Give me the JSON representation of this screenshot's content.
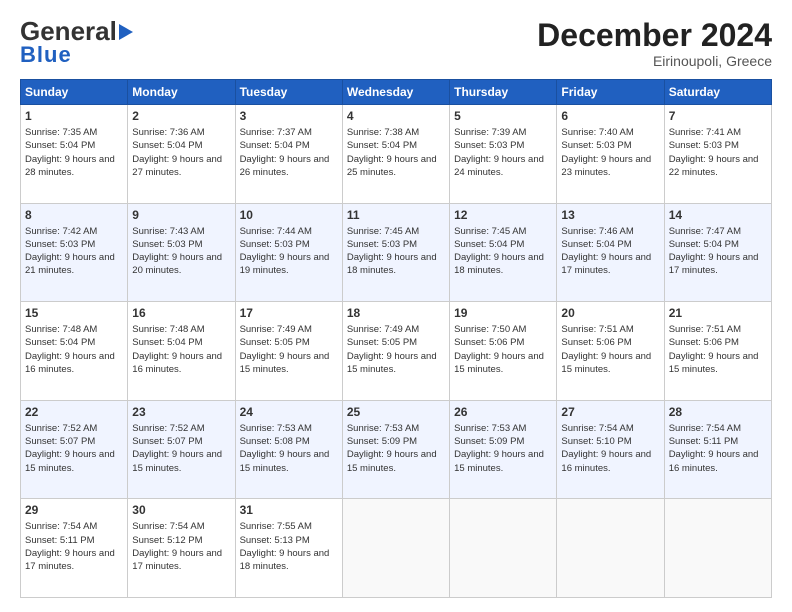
{
  "header": {
    "logo_general": "General",
    "logo_blue": "Blue",
    "month_title": "December 2024",
    "location": "Eirinoupoli, Greece"
  },
  "weekdays": [
    "Sunday",
    "Monday",
    "Tuesday",
    "Wednesday",
    "Thursday",
    "Friday",
    "Saturday"
  ],
  "weeks": [
    [
      {
        "day": "1",
        "sunrise": "Sunrise: 7:35 AM",
        "sunset": "Sunset: 5:04 PM",
        "daylight": "Daylight: 9 hours and 28 minutes."
      },
      {
        "day": "2",
        "sunrise": "Sunrise: 7:36 AM",
        "sunset": "Sunset: 5:04 PM",
        "daylight": "Daylight: 9 hours and 27 minutes."
      },
      {
        "day": "3",
        "sunrise": "Sunrise: 7:37 AM",
        "sunset": "Sunset: 5:04 PM",
        "daylight": "Daylight: 9 hours and 26 minutes."
      },
      {
        "day": "4",
        "sunrise": "Sunrise: 7:38 AM",
        "sunset": "Sunset: 5:04 PM",
        "daylight": "Daylight: 9 hours and 25 minutes."
      },
      {
        "day": "5",
        "sunrise": "Sunrise: 7:39 AM",
        "sunset": "Sunset: 5:03 PM",
        "daylight": "Daylight: 9 hours and 24 minutes."
      },
      {
        "day": "6",
        "sunrise": "Sunrise: 7:40 AM",
        "sunset": "Sunset: 5:03 PM",
        "daylight": "Daylight: 9 hours and 23 minutes."
      },
      {
        "day": "7",
        "sunrise": "Sunrise: 7:41 AM",
        "sunset": "Sunset: 5:03 PM",
        "daylight": "Daylight: 9 hours and 22 minutes."
      }
    ],
    [
      {
        "day": "8",
        "sunrise": "Sunrise: 7:42 AM",
        "sunset": "Sunset: 5:03 PM",
        "daylight": "Daylight: 9 hours and 21 minutes."
      },
      {
        "day": "9",
        "sunrise": "Sunrise: 7:43 AM",
        "sunset": "Sunset: 5:03 PM",
        "daylight": "Daylight: 9 hours and 20 minutes."
      },
      {
        "day": "10",
        "sunrise": "Sunrise: 7:44 AM",
        "sunset": "Sunset: 5:03 PM",
        "daylight": "Daylight: 9 hours and 19 minutes."
      },
      {
        "day": "11",
        "sunrise": "Sunrise: 7:45 AM",
        "sunset": "Sunset: 5:03 PM",
        "daylight": "Daylight: 9 hours and 18 minutes."
      },
      {
        "day": "12",
        "sunrise": "Sunrise: 7:45 AM",
        "sunset": "Sunset: 5:04 PM",
        "daylight": "Daylight: 9 hours and 18 minutes."
      },
      {
        "day": "13",
        "sunrise": "Sunrise: 7:46 AM",
        "sunset": "Sunset: 5:04 PM",
        "daylight": "Daylight: 9 hours and 17 minutes."
      },
      {
        "day": "14",
        "sunrise": "Sunrise: 7:47 AM",
        "sunset": "Sunset: 5:04 PM",
        "daylight": "Daylight: 9 hours and 17 minutes."
      }
    ],
    [
      {
        "day": "15",
        "sunrise": "Sunrise: 7:48 AM",
        "sunset": "Sunset: 5:04 PM",
        "daylight": "Daylight: 9 hours and 16 minutes."
      },
      {
        "day": "16",
        "sunrise": "Sunrise: 7:48 AM",
        "sunset": "Sunset: 5:04 PM",
        "daylight": "Daylight: 9 hours and 16 minutes."
      },
      {
        "day": "17",
        "sunrise": "Sunrise: 7:49 AM",
        "sunset": "Sunset: 5:05 PM",
        "daylight": "Daylight: 9 hours and 15 minutes."
      },
      {
        "day": "18",
        "sunrise": "Sunrise: 7:49 AM",
        "sunset": "Sunset: 5:05 PM",
        "daylight": "Daylight: 9 hours and 15 minutes."
      },
      {
        "day": "19",
        "sunrise": "Sunrise: 7:50 AM",
        "sunset": "Sunset: 5:06 PM",
        "daylight": "Daylight: 9 hours and 15 minutes."
      },
      {
        "day": "20",
        "sunrise": "Sunrise: 7:51 AM",
        "sunset": "Sunset: 5:06 PM",
        "daylight": "Daylight: 9 hours and 15 minutes."
      },
      {
        "day": "21",
        "sunrise": "Sunrise: 7:51 AM",
        "sunset": "Sunset: 5:06 PM",
        "daylight": "Daylight: 9 hours and 15 minutes."
      }
    ],
    [
      {
        "day": "22",
        "sunrise": "Sunrise: 7:52 AM",
        "sunset": "Sunset: 5:07 PM",
        "daylight": "Daylight: 9 hours and 15 minutes."
      },
      {
        "day": "23",
        "sunrise": "Sunrise: 7:52 AM",
        "sunset": "Sunset: 5:07 PM",
        "daylight": "Daylight: 9 hours and 15 minutes."
      },
      {
        "day": "24",
        "sunrise": "Sunrise: 7:53 AM",
        "sunset": "Sunset: 5:08 PM",
        "daylight": "Daylight: 9 hours and 15 minutes."
      },
      {
        "day": "25",
        "sunrise": "Sunrise: 7:53 AM",
        "sunset": "Sunset: 5:09 PM",
        "daylight": "Daylight: 9 hours and 15 minutes."
      },
      {
        "day": "26",
        "sunrise": "Sunrise: 7:53 AM",
        "sunset": "Sunset: 5:09 PM",
        "daylight": "Daylight: 9 hours and 15 minutes."
      },
      {
        "day": "27",
        "sunrise": "Sunrise: 7:54 AM",
        "sunset": "Sunset: 5:10 PM",
        "daylight": "Daylight: 9 hours and 16 minutes."
      },
      {
        "day": "28",
        "sunrise": "Sunrise: 7:54 AM",
        "sunset": "Sunset: 5:11 PM",
        "daylight": "Daylight: 9 hours and 16 minutes."
      }
    ],
    [
      {
        "day": "29",
        "sunrise": "Sunrise: 7:54 AM",
        "sunset": "Sunset: 5:11 PM",
        "daylight": "Daylight: 9 hours and 17 minutes."
      },
      {
        "day": "30",
        "sunrise": "Sunrise: 7:54 AM",
        "sunset": "Sunset: 5:12 PM",
        "daylight": "Daylight: 9 hours and 17 minutes."
      },
      {
        "day": "31",
        "sunrise": "Sunrise: 7:55 AM",
        "sunset": "Sunset: 5:13 PM",
        "daylight": "Daylight: 9 hours and 18 minutes."
      },
      null,
      null,
      null,
      null
    ]
  ]
}
